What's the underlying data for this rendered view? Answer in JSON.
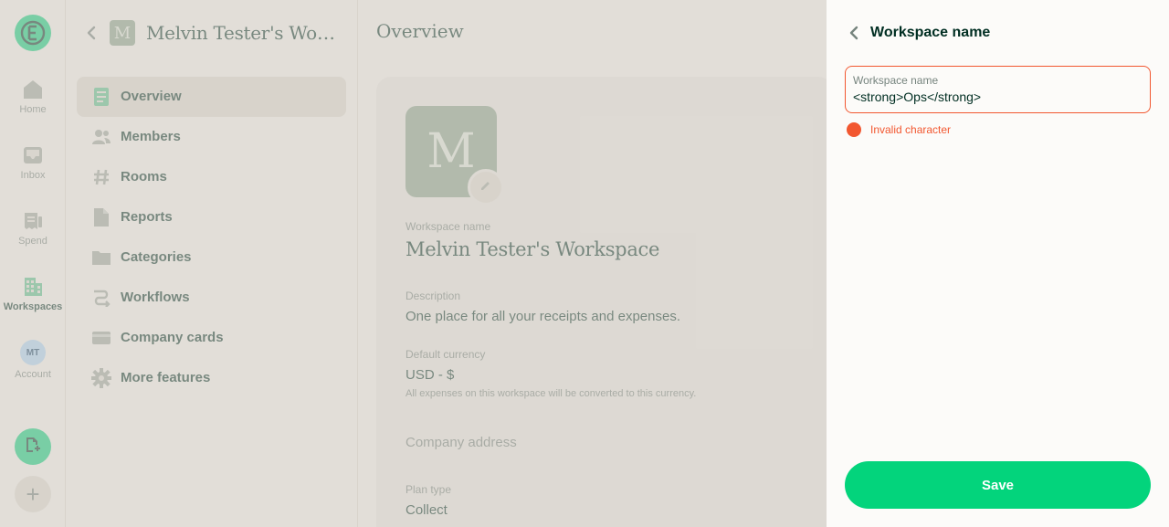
{
  "rail": {
    "items": [
      {
        "label": "Home",
        "icon": "home-icon"
      },
      {
        "label": "Inbox",
        "icon": "inbox-icon"
      },
      {
        "label": "Spend",
        "icon": "receipt-icon"
      },
      {
        "label": "Workspaces",
        "icon": "building-icon"
      },
      {
        "label": "Account",
        "icon": "avatar"
      }
    ],
    "account_initials": "MT",
    "active": "Workspaces"
  },
  "workspace": {
    "initial": "M",
    "name": "Melvin Tester's Workspace",
    "menu": [
      {
        "label": "Overview",
        "icon": "document-icon"
      },
      {
        "label": "Members",
        "icon": "users-icon"
      },
      {
        "label": "Rooms",
        "icon": "hashtag-icon"
      },
      {
        "label": "Reports",
        "icon": "file-icon"
      },
      {
        "label": "Categories",
        "icon": "folder-icon"
      },
      {
        "label": "Workflows",
        "icon": "workflow-icon"
      },
      {
        "label": "Company cards",
        "icon": "credit-card-icon"
      },
      {
        "label": "More features",
        "icon": "gear-icon"
      }
    ],
    "active_menu": "Overview"
  },
  "overview": {
    "title": "Overview",
    "avatar_initial": "M",
    "name_label": "Workspace name",
    "name_value": "Melvin Tester's Workspace",
    "description_label": "Description",
    "description_value": "One place for all your receipts and expenses.",
    "currency_label": "Default currency",
    "currency_value": "USD - $",
    "currency_hint": "All expenses on this workspace will be converted to this currency.",
    "address_placeholder": "Company address",
    "plan_label": "Plan type",
    "plan_value": "Collect"
  },
  "panel": {
    "title": "Workspace name",
    "input_label": "Workspace name",
    "input_value": "<strong>Ops</strong>",
    "error_text": "Invalid character",
    "save_label": "Save"
  },
  "colors": {
    "accent": "#03d47c",
    "error": "#f25730",
    "text": "#002e22",
    "muted": "#76847e",
    "workspace_avatar": "#8aa48f"
  }
}
